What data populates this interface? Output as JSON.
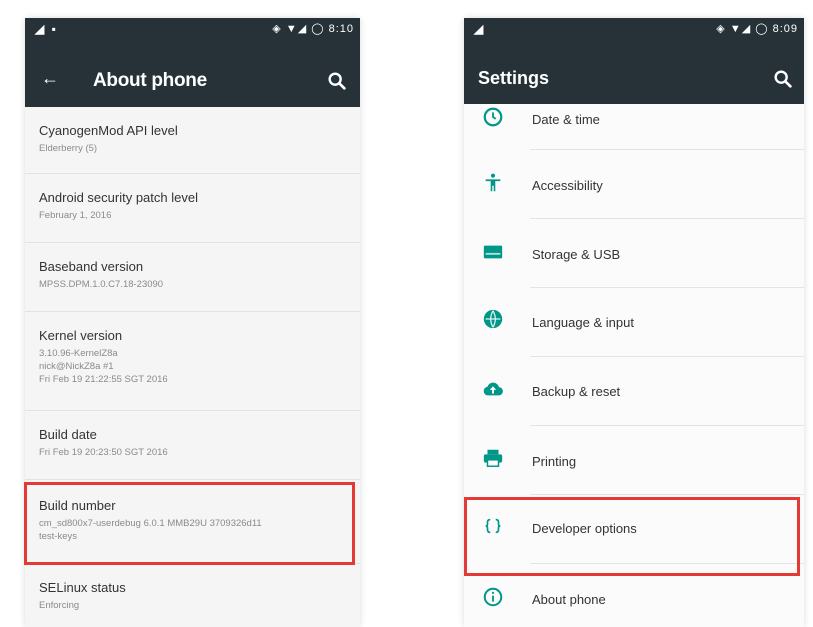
{
  "colors": {
    "appbar": "#263238",
    "accent": "#009688",
    "highlight": "#e53935"
  },
  "left": {
    "statusbar": {
      "left": "◢ ▪",
      "right": "◈ ▼◢ ◯ 8:10"
    },
    "title": "About phone",
    "items": [
      {
        "title": "CyanogenMod API level",
        "summary": "Elderberry (5)"
      },
      {
        "title": "Android security patch level",
        "summary": "February 1, 2016"
      },
      {
        "title": "Baseband version",
        "summary": "MPSS.DPM.1.0.C7.18-23090"
      },
      {
        "title": "Kernel version",
        "summary": "3.10.96-KernelZ8a\nnick@NickZ8a #1\nFri Feb 19 21:22:55 SGT 2016"
      },
      {
        "title": "Build date",
        "summary": "Fri Feb 19 20:23:50 SGT 2016"
      },
      {
        "title": "Build number",
        "summary": "cm_sd800x7-userdebug 6.0.1 MMB29U 3709326d11\ntest-keys"
      },
      {
        "title": "SELinux status",
        "summary": "Enforcing"
      }
    ]
  },
  "right": {
    "statusbar": {
      "left": "◢",
      "right": "◈ ▼◢ ◯ 8:09"
    },
    "title": "Settings",
    "items": [
      {
        "label": "Date & time",
        "icon": "clock-icon"
      },
      {
        "label": "Accessibility",
        "icon": "accessibility-icon"
      },
      {
        "label": "Storage & USB",
        "icon": "storage-icon"
      },
      {
        "label": "Language & input",
        "icon": "globe-icon"
      },
      {
        "label": "Backup & reset",
        "icon": "cloud-upload-icon"
      },
      {
        "label": "Printing",
        "icon": "printer-icon"
      },
      {
        "label": "Developer options",
        "icon": "code-braces-icon"
      },
      {
        "label": "About phone",
        "icon": "info-icon"
      }
    ]
  }
}
